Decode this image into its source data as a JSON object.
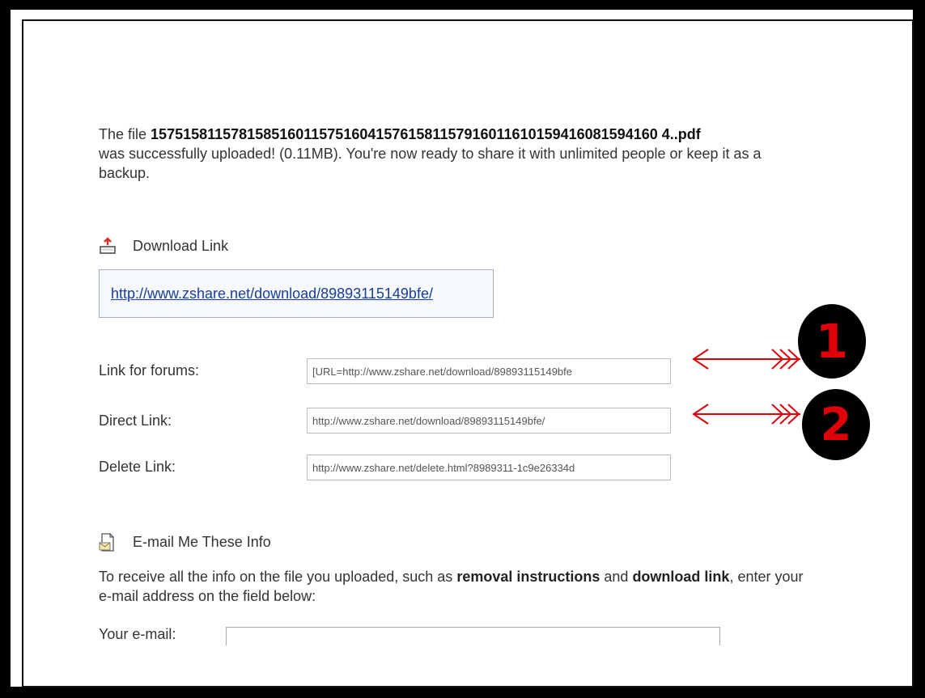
{
  "upload": {
    "prefix": "The file",
    "filename": "157515811578158516011575160415761581157916011610159416081594160 4..pdf",
    "message": "was successfully uploaded! (0.11MB). You're now ready to share it with unlimited people or keep it as a backup."
  },
  "download": {
    "heading": "Download Link",
    "url": "http://www.zshare.net/download/89893115149bfe/"
  },
  "links": [
    {
      "label": "Link for forums:",
      "value": "[URL=http://www.zshare.net/download/89893115149bfe"
    },
    {
      "label": "Direct Link:",
      "value": "http://www.zshare.net/download/89893115149bfe/"
    },
    {
      "label": "Delete Link:",
      "value": "http://www.zshare.net/delete.html?8989311-1c9e26334d"
    }
  ],
  "email": {
    "heading": "E-mail Me These Info",
    "text_1": "To receive all the info on the file you uploaded, such as",
    "bold_1": "removal instructions",
    "text_2": "and",
    "bold_2": "download link",
    "text_3": ", enter your e-mail address on the field below:",
    "field_label": "Your e-mail:",
    "field_value": ""
  },
  "annotations": {
    "badge_1": "1",
    "badge_2": "2",
    "arrow_color": "#e0000a",
    "badge_color": "#000000"
  },
  "icons": [
    "download-icon",
    "email-icon",
    "arrow-icon"
  ]
}
